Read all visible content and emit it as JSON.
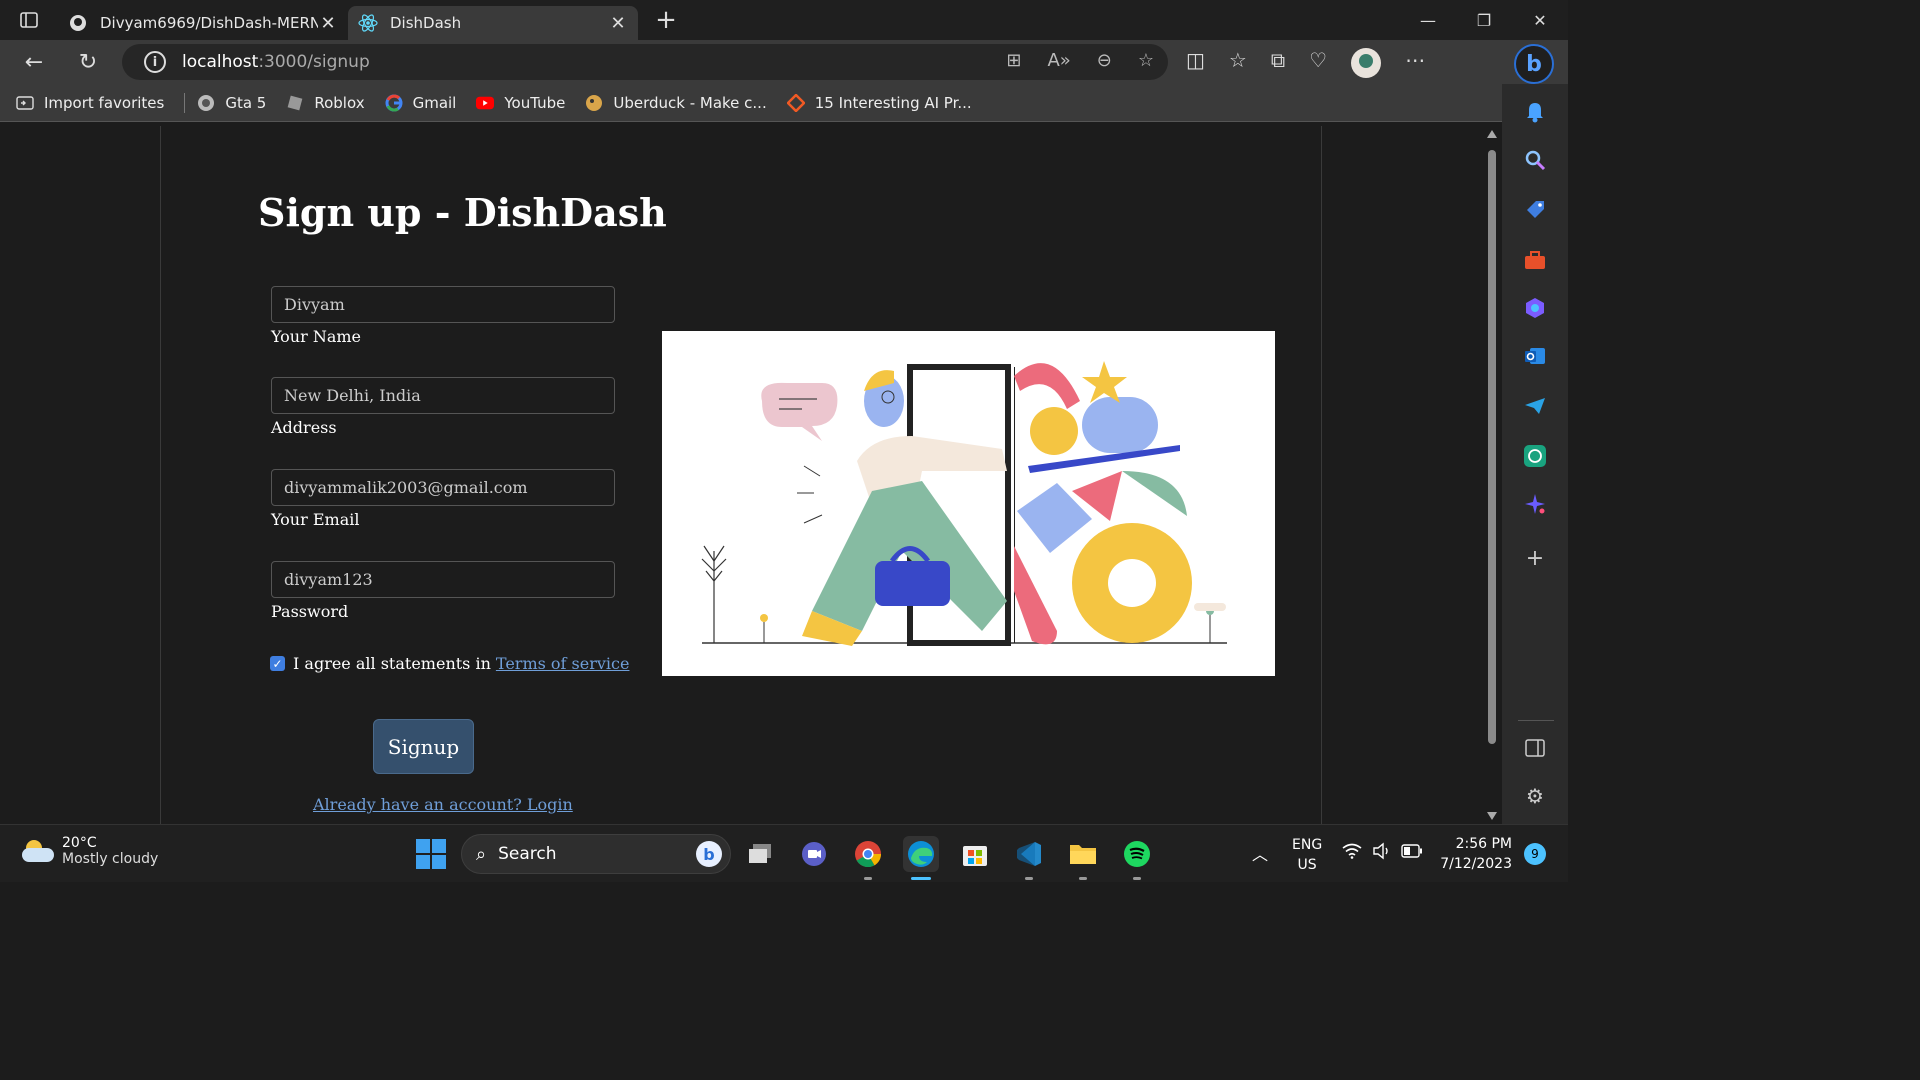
{
  "browser": {
    "tabs": [
      {
        "title": "Divyam6969/DishDash-MERN: D",
        "icon": "github-icon",
        "active": false
      },
      {
        "title": "DishDash",
        "icon": "react-icon",
        "active": true
      }
    ],
    "url_host": "localhost",
    "url_path": ":3000/signup",
    "favorites": [
      {
        "label": "Import favorites",
        "icon": "import-icon"
      },
      {
        "label": "Gta 5",
        "icon": "globe-icon"
      },
      {
        "label": "Roblox",
        "icon": "roblox-icon"
      },
      {
        "label": "Gmail",
        "icon": "google-icon"
      },
      {
        "label": "YouTube",
        "icon": "youtube-icon"
      },
      {
        "label": "Uberduck - Make c...",
        "icon": "uberduck-icon"
      },
      {
        "label": "15 Interesting AI Pr...",
        "icon": "bookmark-icon"
      }
    ]
  },
  "page": {
    "heading": "Sign up - DishDash",
    "fields": [
      {
        "value": "Divyam",
        "label": "Your Name"
      },
      {
        "value": "New Delhi, India",
        "label": "Address"
      },
      {
        "value": "divyammalik2003@gmail.com",
        "label": "Your Email"
      },
      {
        "value": "divyam123",
        "label": "Password"
      }
    ],
    "agree_text": "I agree all statements in",
    "terms_link": "Terms of service",
    "agree_checked": true,
    "signup_button": "Signup",
    "login_link": "Already have an account? Login"
  },
  "taskbar": {
    "weather_temp": "20°C",
    "weather_desc": "Mostly cloudy",
    "search_label": "Search",
    "lang_top": "ENG",
    "lang_bottom": "US",
    "time": "2:56 PM",
    "date": "7/12/2023",
    "notification_count": "9"
  },
  "colors": {
    "accent": "#3f7ee0",
    "link": "#6f9ed8",
    "button": "#35506d"
  }
}
